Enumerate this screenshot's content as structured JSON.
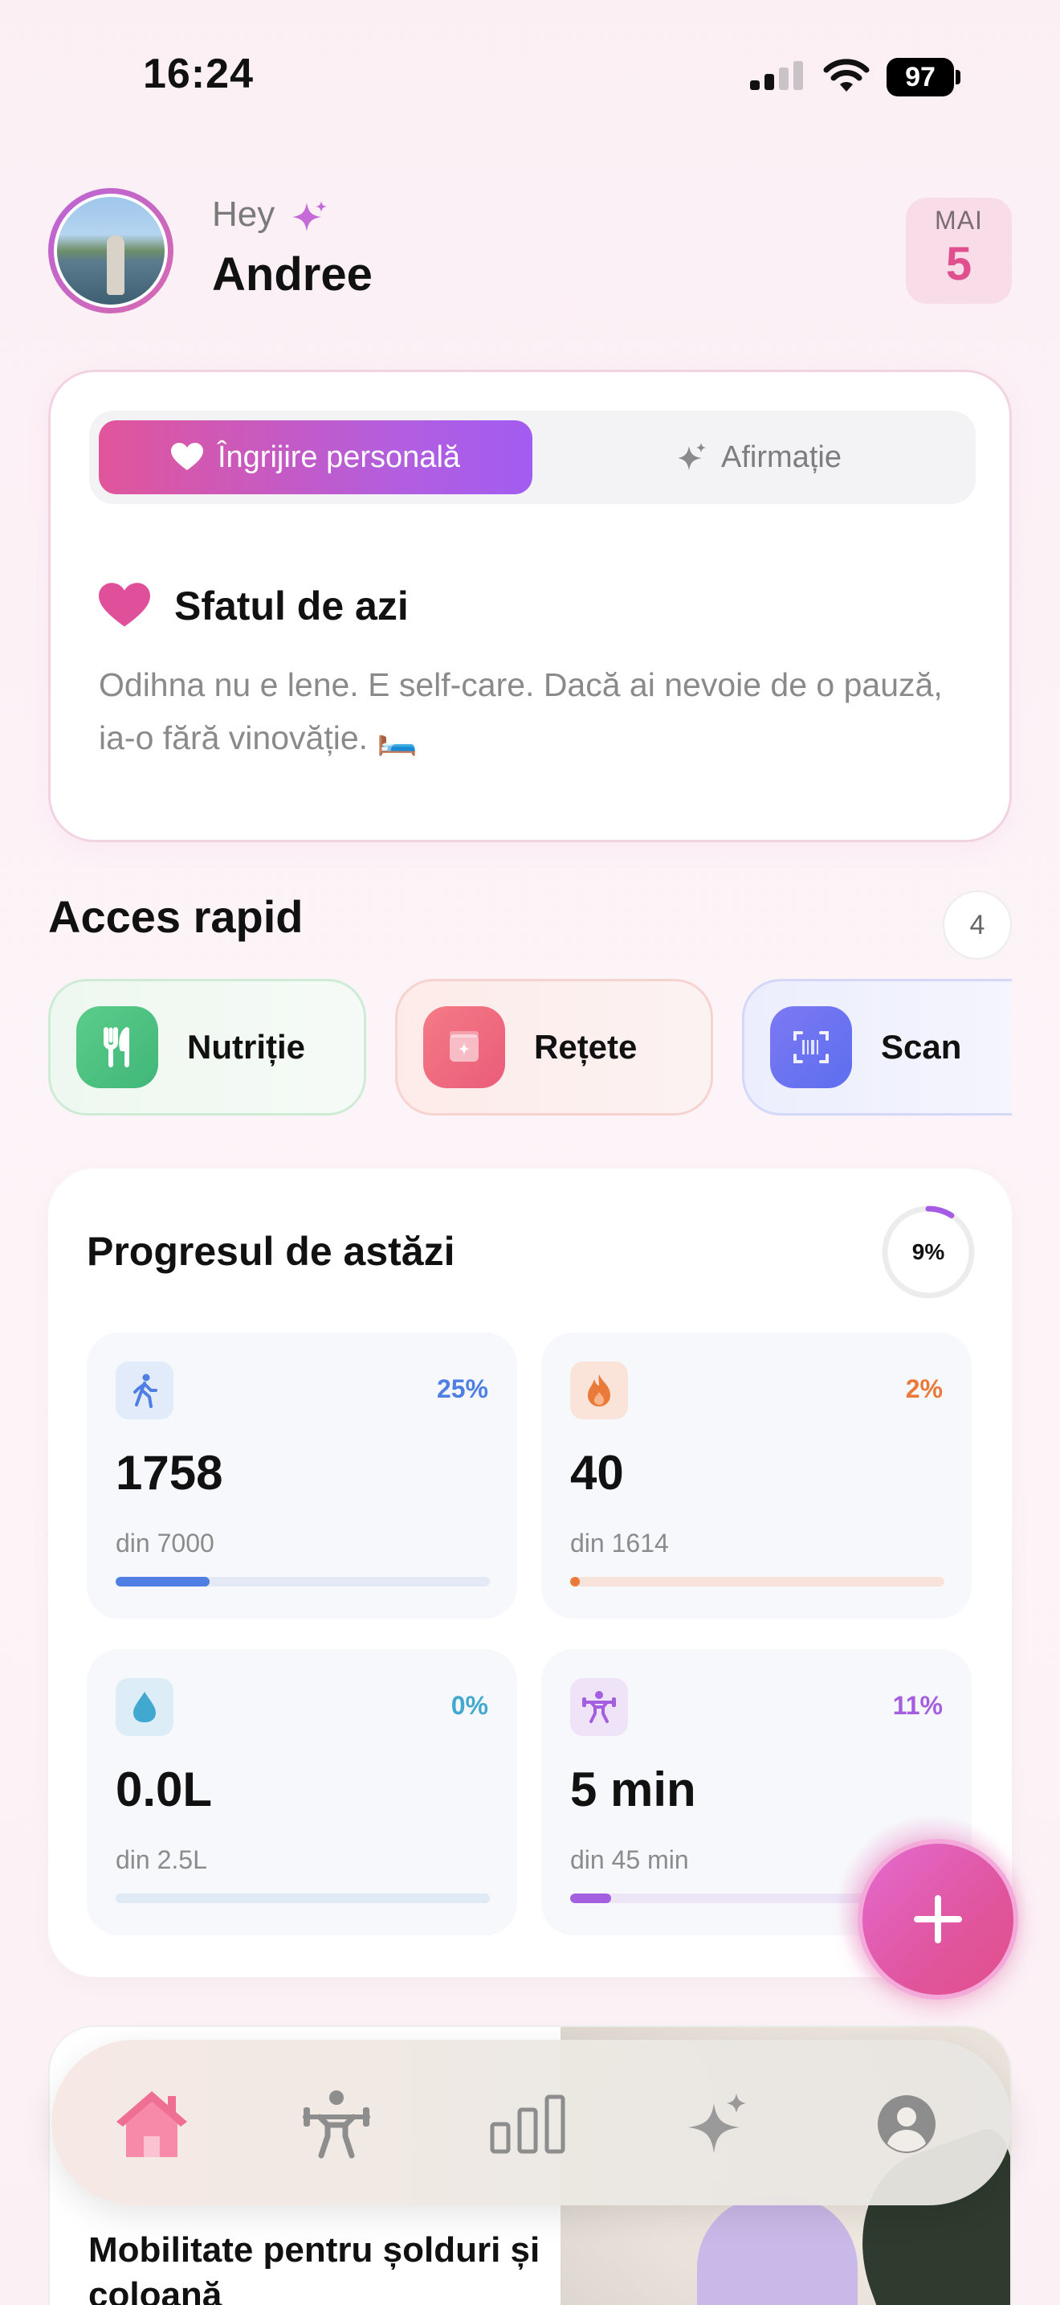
{
  "status_bar": {
    "time": "16:24",
    "battery": "97"
  },
  "header": {
    "greeting": "Hey",
    "user_name": "Andree",
    "date": {
      "month": "MAI",
      "day": "5"
    }
  },
  "tip_card": {
    "tabs": [
      {
        "label": "Îngrijire personală",
        "active": true,
        "icon": "heart-icon"
      },
      {
        "label": "Afirmație",
        "active": false,
        "icon": "sparkle-icon"
      }
    ],
    "title": "Sfatul de azi",
    "text": "Odihna nu e lene. E self-care. Dacă ai nevoie de o pauză, ia-o fără vinovăție. 🛏️"
  },
  "quick_access": {
    "title": "Acces rapid",
    "count": "4",
    "items": [
      {
        "label": "Nutriție",
        "icon": "fork-knife-icon",
        "color": "#4fc280"
      },
      {
        "label": "Rețete",
        "icon": "recipe-book-icon",
        "color": "#ee6a7f"
      },
      {
        "label": "Scan",
        "icon": "barcode-scan-icon",
        "color": "#6c73f1"
      }
    ]
  },
  "progress": {
    "title": "Progresul de astăzi",
    "overall_percent": "9%",
    "overall_fraction": 0.09,
    "stats": [
      {
        "icon": "walking-icon",
        "percent": "25%",
        "fraction": 0.25,
        "value": "1758",
        "goal": "din 7000",
        "color": "#4f7fe3",
        "track": "#e3eaf6"
      },
      {
        "icon": "flame-icon",
        "percent": "2%",
        "fraction": 0.02,
        "value": "40",
        "goal": "din 1614",
        "color": "#ea7a3a",
        "track": "#f7e3da"
      },
      {
        "icon": "water-drop-icon",
        "percent": "0%",
        "fraction": 0.0,
        "value": "0.0L",
        "goal": "din 2.5L",
        "color": "#41a9cf",
        "track": "#dfeaf4"
      },
      {
        "icon": "weightlifting-icon",
        "percent": "11%",
        "fraction": 0.11,
        "value": "5 min",
        "goal": "din 45 min",
        "color": "#a45ee0",
        "track": "#ece5f5"
      }
    ]
  },
  "workout_card": {
    "title": "Mobilitate pentru șolduri și coloană"
  },
  "bottom_nav": {
    "items": [
      {
        "icon": "home-icon",
        "active": true
      },
      {
        "icon": "workout-icon",
        "active": false
      },
      {
        "icon": "stats-icon",
        "active": false
      },
      {
        "icon": "ai-sparkle-icon",
        "active": false
      },
      {
        "icon": "profile-icon",
        "active": false
      }
    ]
  },
  "fab": {
    "icon": "plus-icon"
  }
}
